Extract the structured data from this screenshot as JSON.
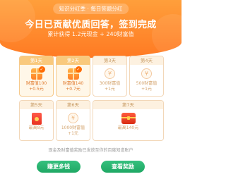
{
  "header": {
    "pill": "知识分红季 · 每日答题分红",
    "title": "今日已贡献优质回答，签到完成",
    "subtitle": "累计获得 1.2元现金 + 240财富值"
  },
  "days": [
    {
      "label": "第1天",
      "line1": "财富值100",
      "line2": "+0.5元",
      "state": "done",
      "icon": "gift-icon"
    },
    {
      "label": "第2天",
      "line1": "财富值140",
      "line2": "+0.7元",
      "state": "done",
      "icon": "gift-icon"
    },
    {
      "label": "第3天",
      "line1": "300财富值",
      "line2": "+1元",
      "state": "pending",
      "icon": "coin-icon"
    },
    {
      "label": "第4天",
      "line1": "500财富值",
      "line2": "+1元",
      "state": "pending",
      "icon": "coin-icon"
    },
    {
      "label": "第5天",
      "line1": "最高8元",
      "line2": "",
      "state": "pending",
      "icon": "red-envelope-icon"
    },
    {
      "label": "第6天",
      "line1": "1000财富值",
      "line2": "+1元",
      "state": "pending",
      "icon": "coin-icon"
    },
    {
      "label": "第7天",
      "line1": "最高140元",
      "line2": "",
      "state": "pending",
      "icon": "treasure-chest-icon"
    }
  ],
  "footnote": "现金及财富值奖励已发放至你的百度知道账户",
  "buttons": {
    "answer_more": "赚更多钱",
    "view_rewards": "查看奖励"
  },
  "colors": {
    "header_orange": "#ff8a2b",
    "button_green": "#2bb673",
    "active_card_bg": "#fff7e8"
  }
}
